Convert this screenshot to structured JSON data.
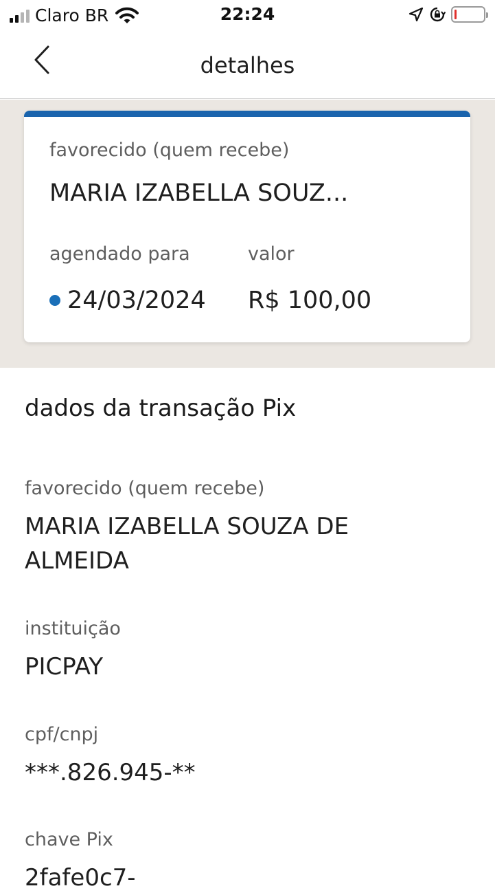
{
  "status_bar": {
    "carrier": "Claro BR",
    "time": "22:24",
    "icons": [
      "signal-icon",
      "wifi-icon",
      "location-arrow-icon",
      "orientation-lock-icon",
      "battery-low-icon"
    ],
    "battery_color": "#e0302c"
  },
  "navbar": {
    "title": "detalhes",
    "back_icon": "chevron-left-icon"
  },
  "summary_card": {
    "accent_color": "#1a64ad",
    "payee_label": "favorecido (quem recebe)",
    "payee_name": "MARIA IZABELLA SOUZ...",
    "scheduled_label": "agendado para",
    "scheduled_date": "24/03/2024",
    "amount_label": "valor",
    "amount": "R$ 100,00",
    "status_dot_color": "#1a6fb8"
  },
  "details": {
    "section_title": "dados da transação Pix",
    "fields": [
      {
        "label": "favorecido (quem recebe)",
        "value": "MARIA IZABELLA SOUZA DE ALMEIDA"
      },
      {
        "label": "instituição",
        "value": "PICPAY"
      },
      {
        "label": "cpf/cnpj",
        "value": "***.826.945-**"
      },
      {
        "label": "chave Pix",
        "value": "2fafe0c7-"
      }
    ]
  }
}
